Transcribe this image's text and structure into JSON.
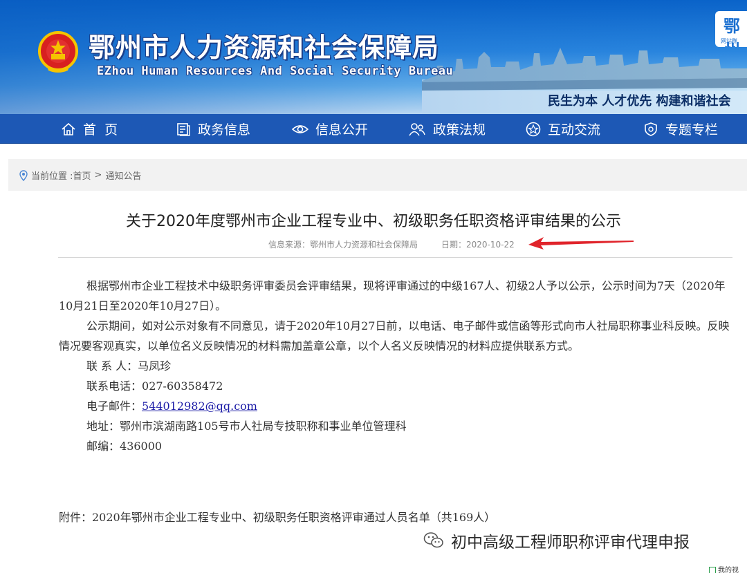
{
  "header": {
    "title_cn": "鄂州市人力资源和社会保障局",
    "title_en": "EZhou Human Resources And Social Security Bureau",
    "slogan": "民生为本 人才优先 构建和谐社会",
    "corner_logo_text": "鄂州",
    "corner_logo_sub": "网站群"
  },
  "nav": {
    "items": [
      {
        "label": "首  页",
        "icon": "home-icon"
      },
      {
        "label": "政务信息",
        "icon": "document-icon"
      },
      {
        "label": "信息公开",
        "icon": "eye-icon"
      },
      {
        "label": "政策法规",
        "icon": "people-icon"
      },
      {
        "label": "互动交流",
        "icon": "star-icon"
      },
      {
        "label": "专题专栏",
        "icon": "shield-icon"
      }
    ]
  },
  "breadcrumb": {
    "prefix": "当前位置 :",
    "home": "首页",
    "separator": ">",
    "current": "通知公告"
  },
  "article": {
    "title": "关于2020年度鄂州市企业工程专业中、初级职务任职资格评审结果的公示",
    "source": "信息来源：鄂州市人力资源和社会保障局",
    "date": "日期：2020-10-22",
    "para1": "根据鄂州市企业工程技术中级职务评审委员会评审结果，现将评审通过的中级167人、初级2人予以公示，公示时间为7天（2020年10月21日至2020年10月27日）。",
    "para2": "公示期间，如对公示对象有不同意见，请于2020年10月27日前，以电话、电子邮件或信函等形式向市人社局职称事业科反映。反映情况要客观真实，以单位名义反映情况的材料需加盖章公章，以个人名义反映情况的材料应提供联系方式。",
    "contact_label": "联 系 人：",
    "contact_value": "马凤珍",
    "phone_label": "联系电话：",
    "phone_value": "027-60358472",
    "email_label": "电子邮件：",
    "email_value": "544012982@qq.com",
    "address_label": "地址：",
    "address_value": "鄂州市滨湖南路105号市人社局专技职称和事业单位管理科",
    "zip_label": "邮编：",
    "zip_value": "436000",
    "attachment": "附件：2020年鄂州市企业工程专业中、初级职务任职资格评审通过人员名单（共169人）"
  },
  "watermark": {
    "text": "初中高级工程师职称评审代理申报"
  },
  "corner_button": {
    "label": "我的视"
  },
  "colors": {
    "nav_bg": "#1d58b5",
    "banner_blue": "#0a63c9",
    "arrow_red": "#e0242b",
    "link_blue": "#1a1aa6"
  }
}
